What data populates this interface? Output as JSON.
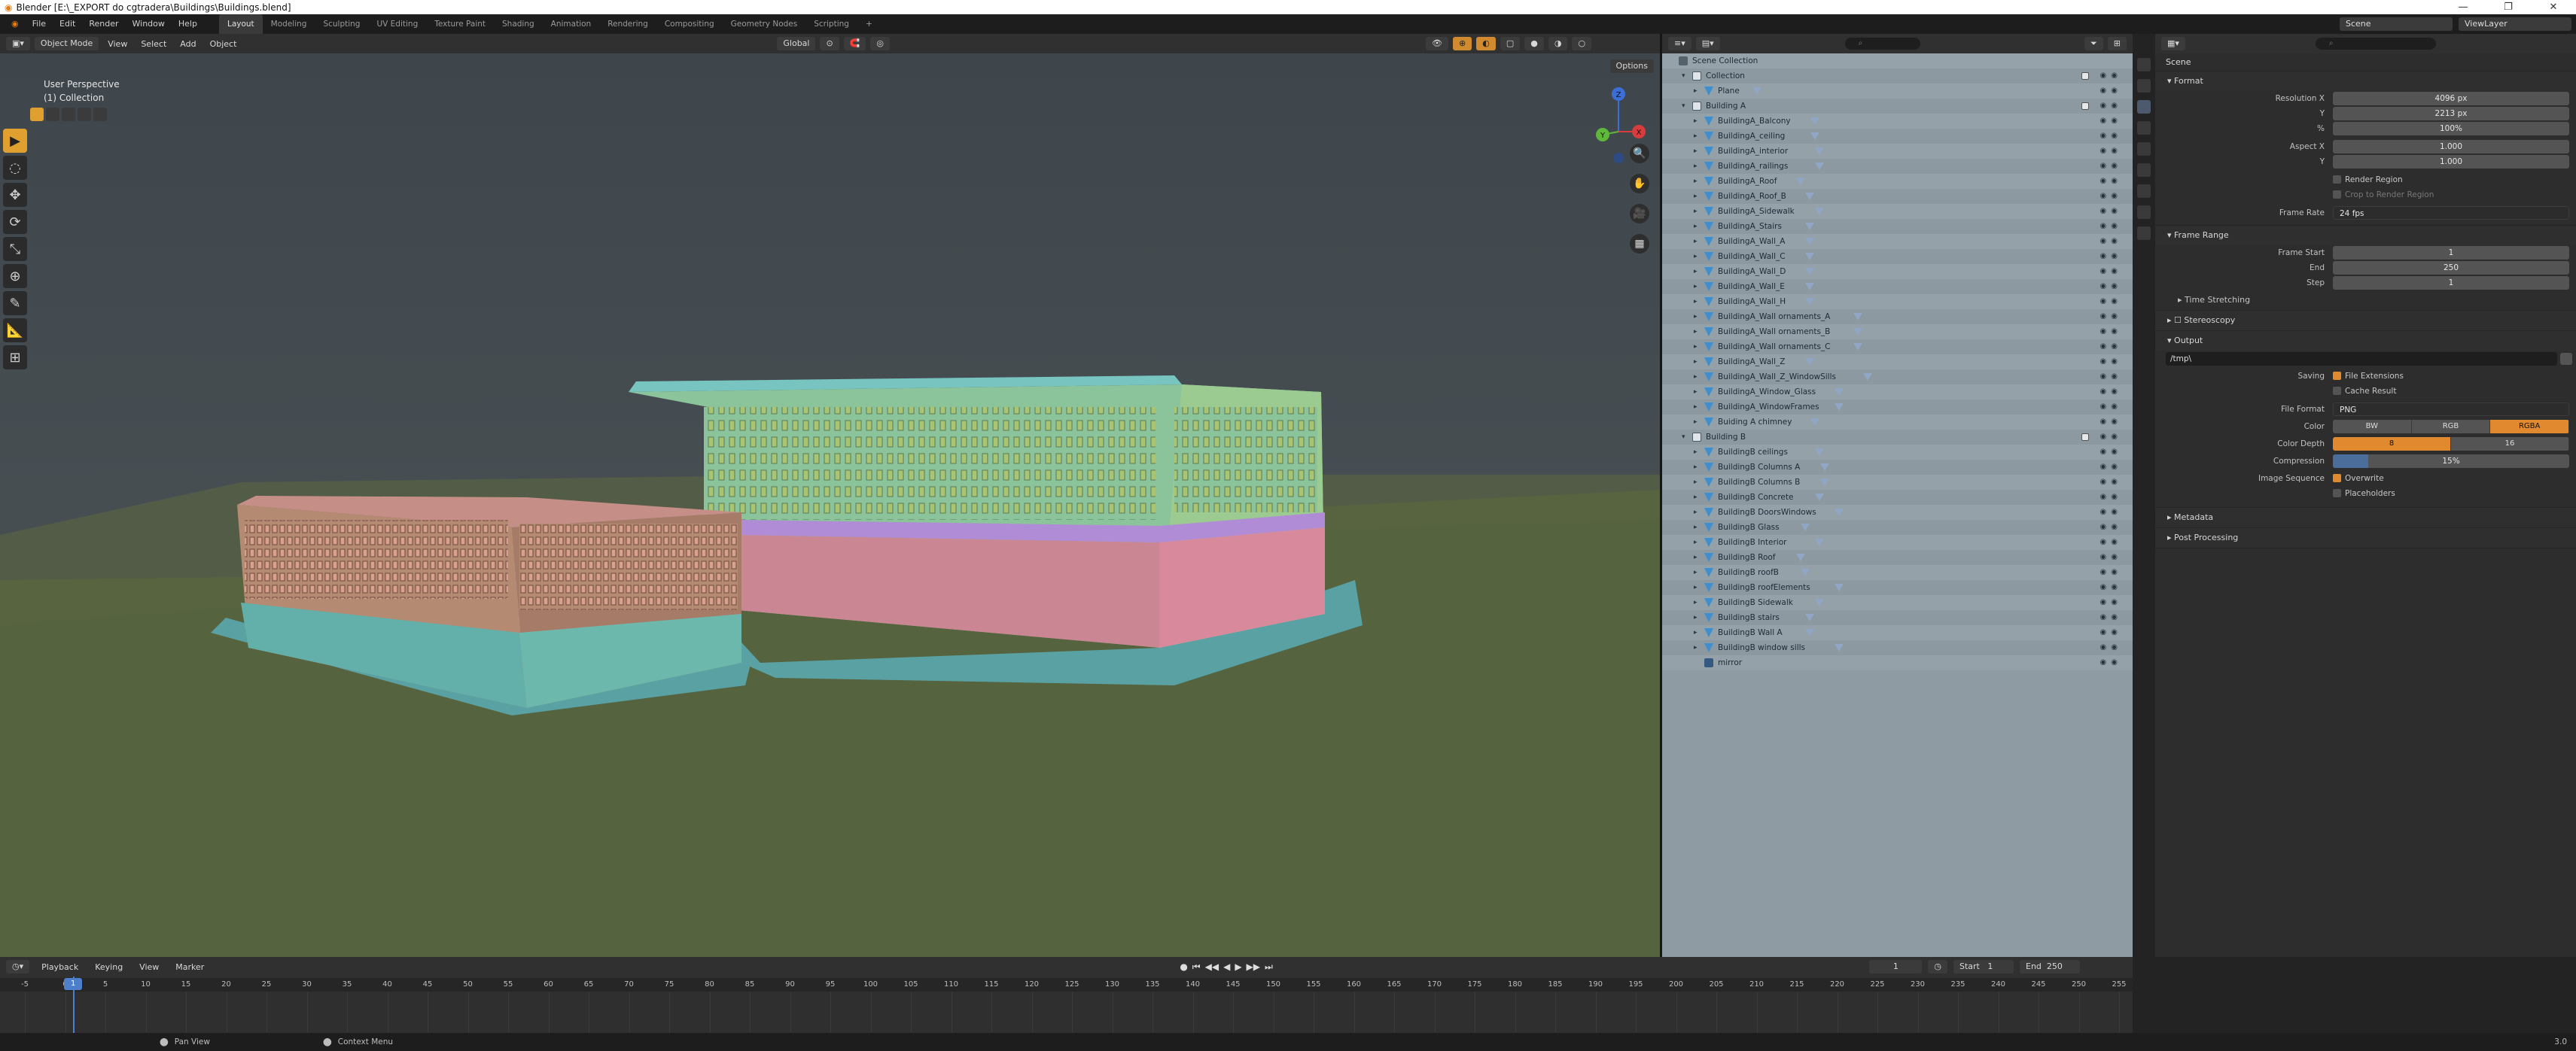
{
  "window": {
    "title": "Blender [E:\\_EXPORT do cgtradera\\Buildings\\Buildings.blend]",
    "controls": [
      "—",
      "❐",
      "✕"
    ]
  },
  "menu": [
    "File",
    "Edit",
    "Render",
    "Window",
    "Help"
  ],
  "workspaces": [
    "Layout",
    "Modeling",
    "Sculpting",
    "UV Editing",
    "Texture Paint",
    "Shading",
    "Animation",
    "Rendering",
    "Compositing",
    "Geometry Nodes",
    "Scripting"
  ],
  "workspace_add": "+",
  "top_right": {
    "scene": "Scene",
    "view_layer": "ViewLayer"
  },
  "viewport": {
    "mode": "Object Mode",
    "menus": [
      "View",
      "Select",
      "Add",
      "Object"
    ],
    "orientation": "Global",
    "options": "Options",
    "perspective_label": "User Perspective",
    "collection_label": "(1) Collection",
    "gizmo": {
      "x": "X",
      "y": "Y",
      "z": "Z"
    },
    "tools": [
      "▶",
      "◌",
      "✥",
      "⟳",
      "⤡",
      "⊕",
      "✎",
      "📐",
      "⊞"
    ],
    "nav": [
      "🔍",
      "✋",
      "🎥",
      "▦"
    ]
  },
  "outliner": {
    "root": "Scene Collection",
    "rows": [
      {
        "name": "Collection",
        "indent": 1,
        "type": "coll",
        "twisty": "▾",
        "chk": true
      },
      {
        "name": "Plane",
        "indent": 2,
        "type": "obj",
        "twisty": "▸",
        "mat": true
      },
      {
        "name": "Building A",
        "indent": 1,
        "type": "coll",
        "twisty": "▾",
        "chk": true
      },
      {
        "name": "BuildingA_Balcony",
        "indent": 2,
        "type": "obj",
        "twisty": "▸",
        "mat": true
      },
      {
        "name": "BuildingA_ceiling",
        "indent": 2,
        "type": "obj",
        "twisty": "▸",
        "mat": true
      },
      {
        "name": "BuildingA_interior",
        "indent": 2,
        "type": "obj",
        "twisty": "▸",
        "mat": true
      },
      {
        "name": "BuildingA_railings",
        "indent": 2,
        "type": "obj",
        "twisty": "▸",
        "mat": true
      },
      {
        "name": "BuildingA_Roof",
        "indent": 2,
        "type": "obj",
        "twisty": "▸",
        "mat": true
      },
      {
        "name": "BuildingA_Roof_B",
        "indent": 2,
        "type": "obj",
        "twisty": "▸",
        "mat": true
      },
      {
        "name": "BuildingA_Sidewalk",
        "indent": 2,
        "type": "obj",
        "twisty": "▸",
        "mat": true
      },
      {
        "name": "BuildingA_Stairs",
        "indent": 2,
        "type": "obj",
        "twisty": "▸",
        "mat": true
      },
      {
        "name": "BuildingA_Wall_A",
        "indent": 2,
        "type": "obj",
        "twisty": "▸",
        "mat": true
      },
      {
        "name": "BuildingA_Wall_C",
        "indent": 2,
        "type": "obj",
        "twisty": "▸",
        "mat": true
      },
      {
        "name": "BuildingA_Wall_D",
        "indent": 2,
        "type": "obj",
        "twisty": "▸",
        "mat": true
      },
      {
        "name": "BuildingA_Wall_E",
        "indent": 2,
        "type": "obj",
        "twisty": "▸",
        "mat": true
      },
      {
        "name": "BuildingA_Wall_H",
        "indent": 2,
        "type": "obj",
        "twisty": "▸",
        "mat": true
      },
      {
        "name": "BuildingA_Wall ornaments_A",
        "indent": 2,
        "type": "obj",
        "twisty": "▸",
        "mat": true
      },
      {
        "name": "BuildingA_Wall ornaments_B",
        "indent": 2,
        "type": "obj",
        "twisty": "▸",
        "mat": true
      },
      {
        "name": "BuildingA_Wall ornaments_C",
        "indent": 2,
        "type": "obj",
        "twisty": "▸",
        "mat": true
      },
      {
        "name": "BuildingA_Wall_Z",
        "indent": 2,
        "type": "obj",
        "twisty": "▸",
        "mat": true
      },
      {
        "name": "BuildingA_Wall_Z_WindowSills",
        "indent": 2,
        "type": "obj",
        "twisty": "▸",
        "mat": true
      },
      {
        "name": "BuildingA_Window_Glass",
        "indent": 2,
        "type": "obj",
        "twisty": "▸",
        "mat": true
      },
      {
        "name": "BuildingA_WindowFrames",
        "indent": 2,
        "type": "obj",
        "twisty": "▸",
        "mat": true
      },
      {
        "name": "Buiding A chimney",
        "indent": 2,
        "type": "obj",
        "twisty": "▸",
        "mat": true
      },
      {
        "name": "Building B",
        "indent": 1,
        "type": "coll",
        "twisty": "▾",
        "chk": true
      },
      {
        "name": "BuildingB ceilings",
        "indent": 2,
        "type": "obj",
        "twisty": "▸",
        "mat": true
      },
      {
        "name": "BuildingB Columns A",
        "indent": 2,
        "type": "obj",
        "twisty": "▸",
        "mat": true
      },
      {
        "name": "BuildingB Columns B",
        "indent": 2,
        "type": "obj",
        "twisty": "▸",
        "mat": true
      },
      {
        "name": "BuildingB Concrete",
        "indent": 2,
        "type": "obj",
        "twisty": "▸",
        "mat": true
      },
      {
        "name": "BuildingB DoorsWindows",
        "indent": 2,
        "type": "obj",
        "twisty": "▸",
        "mat": true
      },
      {
        "name": "BuildingB Glass",
        "indent": 2,
        "type": "obj",
        "twisty": "▸",
        "mat": true
      },
      {
        "name": "BuildingB Interior",
        "indent": 2,
        "type": "obj",
        "twisty": "▸",
        "mat": true
      },
      {
        "name": "BuildingB Roof",
        "indent": 2,
        "type": "obj",
        "twisty": "▸",
        "mat": true
      },
      {
        "name": "BuildingB roofB",
        "indent": 2,
        "type": "obj",
        "twisty": "▸",
        "mat": true
      },
      {
        "name": "BuildingB roofElements",
        "indent": 2,
        "type": "obj",
        "twisty": "▸",
        "mat": true
      },
      {
        "name": "BuildingB Sidewalk",
        "indent": 2,
        "type": "obj",
        "twisty": "▸",
        "mat": true
      },
      {
        "name": "BuildingB stairs",
        "indent": 2,
        "type": "obj",
        "twisty": "▸",
        "mat": true
      },
      {
        "name": "BuildingB Wall A",
        "indent": 2,
        "type": "obj",
        "twisty": "▸",
        "mat": true
      },
      {
        "name": "BuildingB window sills",
        "indent": 2,
        "type": "obj",
        "twisty": "▸",
        "mat": true
      },
      {
        "name": "mirror",
        "indent": 2,
        "type": "empty",
        "twisty": "",
        "mat": false
      }
    ]
  },
  "properties": {
    "context": "Scene",
    "format": {
      "title": "Format",
      "res_x_label": "Resolution X",
      "res_x": "4096 px",
      "res_y_label": "Y",
      "res_y": "2213 px",
      "pct_label": "%",
      "pct": "100%",
      "aspect_x_label": "Aspect X",
      "aspect_x": "1.000",
      "aspect_y_label": "Y",
      "aspect_y": "1.000",
      "render_region": "Render Region",
      "crop": "Crop to Render Region",
      "frame_rate_label": "Frame Rate",
      "frame_rate": "24 fps"
    },
    "frame_range": {
      "title": "Frame Range",
      "start_label": "Frame Start",
      "start": "1",
      "end_label": "End",
      "end": "250",
      "step_label": "Step",
      "step": "1"
    },
    "time_stretching": "Time Stretching",
    "stereoscopy": "Stereoscopy",
    "output": {
      "title": "Output",
      "path": "/tmp\\",
      "saving_label": "Saving",
      "file_ext": "File Extensions",
      "cache": "Cache Result",
      "format_label": "File Format",
      "format": "PNG",
      "color_label": "Color",
      "color_opts": [
        "BW",
        "RGB",
        "RGBA"
      ],
      "color_sel": 2,
      "depth_label": "Color Depth",
      "depth_opts": [
        "8",
        "16"
      ],
      "depth_sel": 0,
      "compression_label": "Compression",
      "compression": "15%",
      "compression_value": 0.15,
      "imgseq_label": "Image Sequence",
      "overwrite": "Overwrite",
      "placeholders": "Placeholders"
    },
    "metadata": "Metadata",
    "post": "Post Processing"
  },
  "timeline": {
    "menus": [
      "Playback",
      "Keying",
      "View",
      "Marker"
    ],
    "current": "1",
    "start_label": "Start",
    "start": "1",
    "end_label": "End",
    "end": "250",
    "ticks": [
      "-5",
      "0",
      "5",
      "10",
      "15",
      "20",
      "25",
      "30",
      "35",
      "40",
      "45",
      "50",
      "55",
      "60",
      "65",
      "70",
      "75",
      "80",
      "85",
      "90",
      "95",
      "100",
      "105",
      "110",
      "115",
      "120",
      "125",
      "130",
      "135",
      "140",
      "145",
      "150",
      "155",
      "160",
      "165",
      "170",
      "175",
      "180",
      "185",
      "190",
      "195",
      "200",
      "205",
      "210",
      "215",
      "220",
      "225",
      "230",
      "235",
      "240",
      "245",
      "250",
      "255"
    ],
    "playhead": "1",
    "controls": [
      "⏮",
      "◀◀",
      "◀",
      "▶",
      "▶▶",
      "⏭"
    ]
  },
  "status": {
    "pan": "Pan View",
    "context": "Context Menu",
    "version": "3.0"
  }
}
